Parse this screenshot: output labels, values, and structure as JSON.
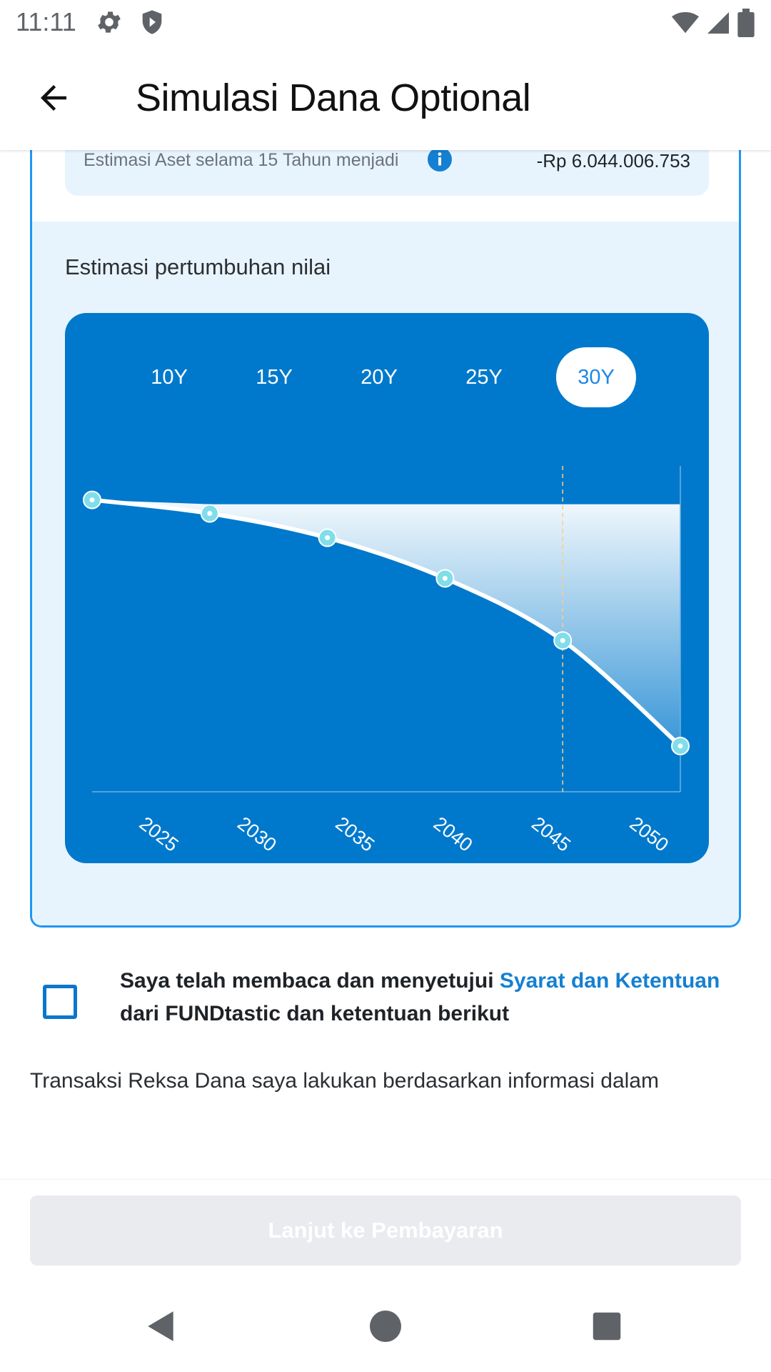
{
  "status_bar": {
    "time": "11:11"
  },
  "app_bar": {
    "title": "Simulasi Dana Optional"
  },
  "estimate": {
    "label": "Estimasi Aset selama 15 Tahun menjadi",
    "value": "-Rp 6.044.006.753"
  },
  "growth": {
    "title": "Estimasi pertumbuhan nilai",
    "tabs": [
      {
        "label": "10Y",
        "active": false
      },
      {
        "label": "15Y",
        "active": false
      },
      {
        "label": "20Y",
        "active": false
      },
      {
        "label": "25Y",
        "active": false
      },
      {
        "label": "30Y",
        "active": true
      }
    ]
  },
  "chart_data": {
    "type": "line",
    "x": [
      2022,
      2028,
      2034,
      2040,
      2046,
      2052
    ],
    "series": [
      {
        "values": [
          0.0,
          -0.05,
          -0.14,
          -0.29,
          -0.52,
          -0.91
        ]
      }
    ],
    "x_tick_labels": [
      "2025",
      "2030",
      "2035",
      "2040",
      "2045",
      "2050"
    ],
    "x_ticks": [
      2025,
      2030,
      2035,
      2040,
      2045,
      2050
    ],
    "xlim": [
      2022,
      2052
    ],
    "ylim": [
      -1,
      0.02
    ],
    "highlight_x": 2046,
    "grid": false,
    "line_color": "#ffffff",
    "marker_color": "#80deea",
    "background": "#0079cc"
  },
  "agreement": {
    "text_pre": "Saya telah membaca dan menyetujui ",
    "link": "Syarat dan Ketentuan",
    "text_post": " dari FUNDtastic dan ketentuan berikut"
  },
  "disclaimer": "Transaksi Reksa Dana saya lakukan berdasarkan informasi dalam",
  "cta": {
    "label": "Lanjut ke Pembayaran"
  }
}
